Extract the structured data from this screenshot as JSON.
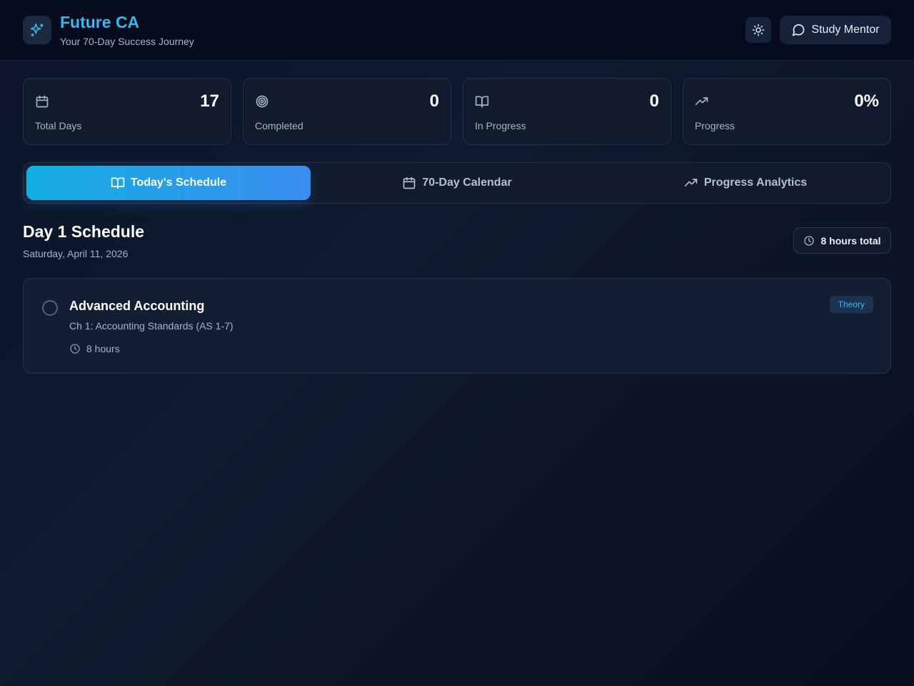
{
  "header": {
    "title": "Future CA",
    "subtitle": "Your 70-Day Success Journey",
    "logo_icon": "sparkles-icon",
    "theme_icon": "sun-icon",
    "mentor_button": "Study Mentor",
    "mentor_icon": "chat-icon"
  },
  "stats": [
    {
      "label": "Total Days",
      "value": "17",
      "icon": "calendar-icon"
    },
    {
      "label": "Completed",
      "value": "0",
      "icon": "target-icon"
    },
    {
      "label": "In Progress",
      "value": "0",
      "icon": "book-open-icon"
    },
    {
      "label": "Progress",
      "value": "0%",
      "icon": "trending-up-icon"
    }
  ],
  "tabs": [
    {
      "label": "Today's Schedule",
      "icon": "book-open-icon",
      "active": true
    },
    {
      "label": "70-Day Calendar",
      "icon": "calendar-icon",
      "active": false
    },
    {
      "label": "Progress Analytics",
      "icon": "trending-up-icon",
      "active": false
    }
  ],
  "schedule": {
    "title": "Day 1 Schedule",
    "date": "Saturday, April 11, 2026",
    "hours_total": "8 hours total"
  },
  "tasks": [
    {
      "title": "Advanced Accounting",
      "chapter": "Ch 1: Accounting Standards (AS 1-7)",
      "hours": "8 hours",
      "tag": "Theory",
      "completed": false
    }
  ],
  "colors": {
    "accent": "#3cb7ec",
    "active_tab_start": "#13aee0",
    "active_tab_end": "#3b8ef0",
    "background": "#0b1428"
  }
}
